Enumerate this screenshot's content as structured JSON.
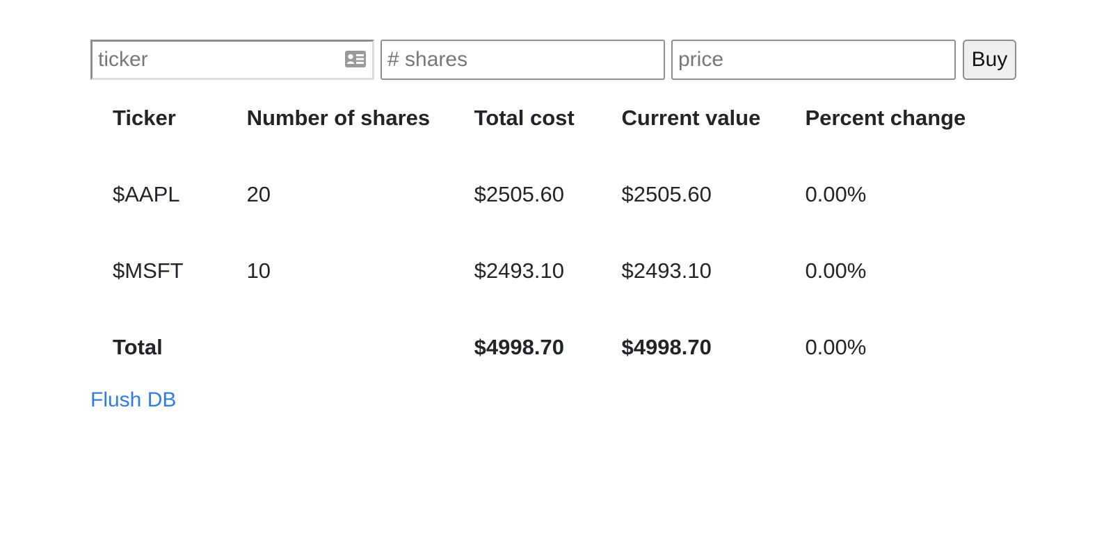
{
  "form": {
    "ticker_placeholder": "ticker",
    "shares_placeholder": "# shares",
    "price_placeholder": "price",
    "buy_label": "Buy",
    "autofill_icon": "contact-card-icon"
  },
  "table": {
    "headers": {
      "ticker": "Ticker",
      "shares": "Number of shares",
      "cost": "Total cost",
      "value": "Current value",
      "pct": "Percent change"
    },
    "rows": [
      {
        "ticker": "$AAPL",
        "shares": "20",
        "cost": "$2505.60",
        "value": "$2505.60",
        "pct": "0.00%"
      },
      {
        "ticker": "$MSFT",
        "shares": "10",
        "cost": "$2493.10",
        "value": "$2493.10",
        "pct": "0.00%"
      }
    ],
    "total": {
      "label": "Total",
      "cost": "$4998.70",
      "value": "$4998.70",
      "pct": "0.00%"
    }
  },
  "links": {
    "flush_db": "Flush DB"
  },
  "colors": {
    "link": "#2f7de1",
    "text": "#212529"
  }
}
